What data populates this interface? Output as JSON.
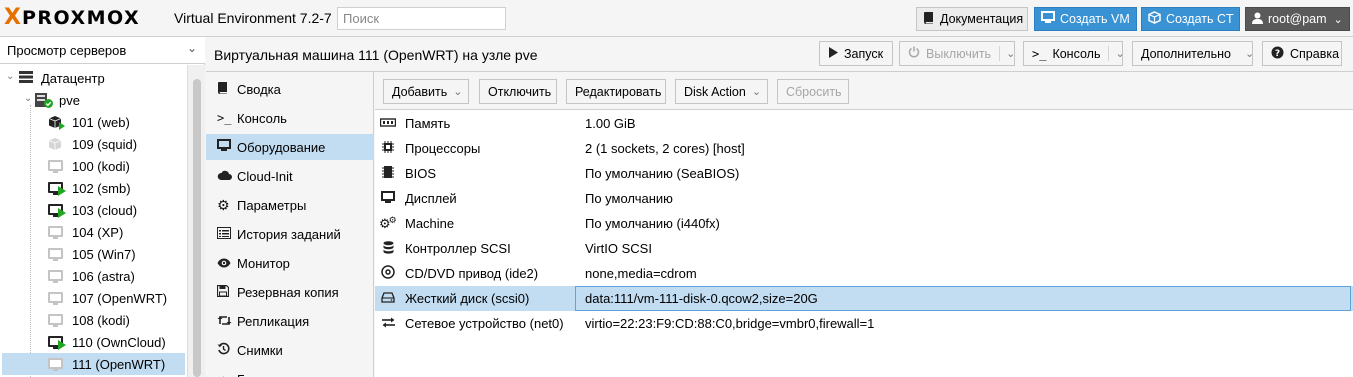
{
  "app": {
    "logo_x": "X",
    "logo_text": "PROXMOX",
    "version": "Virtual Environment 7.2-7",
    "search_placeholder": "Поиск"
  },
  "topbar": {
    "docs": "Документация",
    "create_vm": "Создать VM",
    "create_ct": "Создать CT",
    "user": "root@pam"
  },
  "left": {
    "view_selector": "Просмотр серверов",
    "datacenter": "Датацентр",
    "node": "pve",
    "guests": [
      {
        "label": "101 (web)",
        "type": "ct",
        "running": true
      },
      {
        "label": "109 (squid)",
        "type": "ct",
        "running": false
      },
      {
        "label": "100 (kodi)",
        "type": "vm",
        "running": false
      },
      {
        "label": "102 (smb)",
        "type": "vm",
        "running": true
      },
      {
        "label": "103 (cloud)",
        "type": "vm",
        "running": true
      },
      {
        "label": "104 (XP)",
        "type": "vm",
        "running": false
      },
      {
        "label": "105 (Win7)",
        "type": "vm",
        "running": false
      },
      {
        "label": "106 (astra)",
        "type": "vm",
        "running": false
      },
      {
        "label": "107 (OpenWRT)",
        "type": "vm",
        "running": false
      },
      {
        "label": "108 (kodi)",
        "type": "vm",
        "running": false
      },
      {
        "label": "110 (OwnCloud)",
        "type": "vm",
        "running": true
      },
      {
        "label": "111 (OpenWRT)",
        "type": "vm",
        "running": false,
        "selected": true
      }
    ]
  },
  "header": {
    "title": "Виртуальная машина 111 (OpenWRT) на узле pve",
    "start": "Запуск",
    "shutdown": "Выключить",
    "console": "Консоль",
    "more": "Дополнительно",
    "help": "Справка"
  },
  "nav": {
    "items": [
      {
        "label": "Сводка",
        "icon": "book-icon"
      },
      {
        "label": "Консоль",
        "icon": "terminal-icon"
      },
      {
        "label": "Оборудование",
        "icon": "monitor-icon",
        "selected": true
      },
      {
        "label": "Cloud-Init",
        "icon": "cloud-icon"
      },
      {
        "label": "Параметры",
        "icon": "gear-icon"
      },
      {
        "label": "История заданий",
        "icon": "list-icon"
      },
      {
        "label": "Монитор",
        "icon": "eye-icon"
      },
      {
        "label": "Резервная копия",
        "icon": "floppy-icon"
      },
      {
        "label": "Репликация",
        "icon": "retweet-icon"
      },
      {
        "label": "Снимки",
        "icon": "history-icon"
      },
      {
        "label": "Б",
        "icon": "shield-icon"
      }
    ]
  },
  "toolbar": {
    "add": "Добавить",
    "detach": "Отключить",
    "edit": "Редактировать",
    "disk_action": "Disk Action",
    "reset": "Сбросить"
  },
  "hardware": [
    {
      "name": "Память",
      "value": "1.00 GiB",
      "icon": "memory-icon"
    },
    {
      "name": "Процессоры",
      "value": "2 (1 sockets, 2 cores) [host]",
      "icon": "cpu-icon"
    },
    {
      "name": "BIOS",
      "value": "По умолчанию (SeaBIOS)",
      "icon": "microchip-icon"
    },
    {
      "name": "Дисплей",
      "value": "По умолчанию",
      "icon": "desktop-icon"
    },
    {
      "name": "Machine",
      "value": "По умолчанию (i440fx)",
      "icon": "cogs-icon"
    },
    {
      "name": "Контроллер SCSI",
      "value": "VirtIO SCSI",
      "icon": "database-icon"
    },
    {
      "name": "CD/DVD привод (ide2)",
      "value": "none,media=cdrom",
      "icon": "cdrom-icon"
    },
    {
      "name": "Жесткий диск (scsi0)",
      "value": "data:111/vm-111-disk-0.qcow2,size=20G",
      "icon": "hdd-icon",
      "selected": true
    },
    {
      "name": "Сетевое устройство (net0)",
      "value": "virtio=22:23:F9:CD:88:C0,bridge=vmbr0,firewall=1",
      "icon": "exchange-icon"
    }
  ],
  "colors": {
    "accent": "#3892d4",
    "logo_orange": "#e57000",
    "selection": "#c2ddf2",
    "running": "#21a621"
  }
}
